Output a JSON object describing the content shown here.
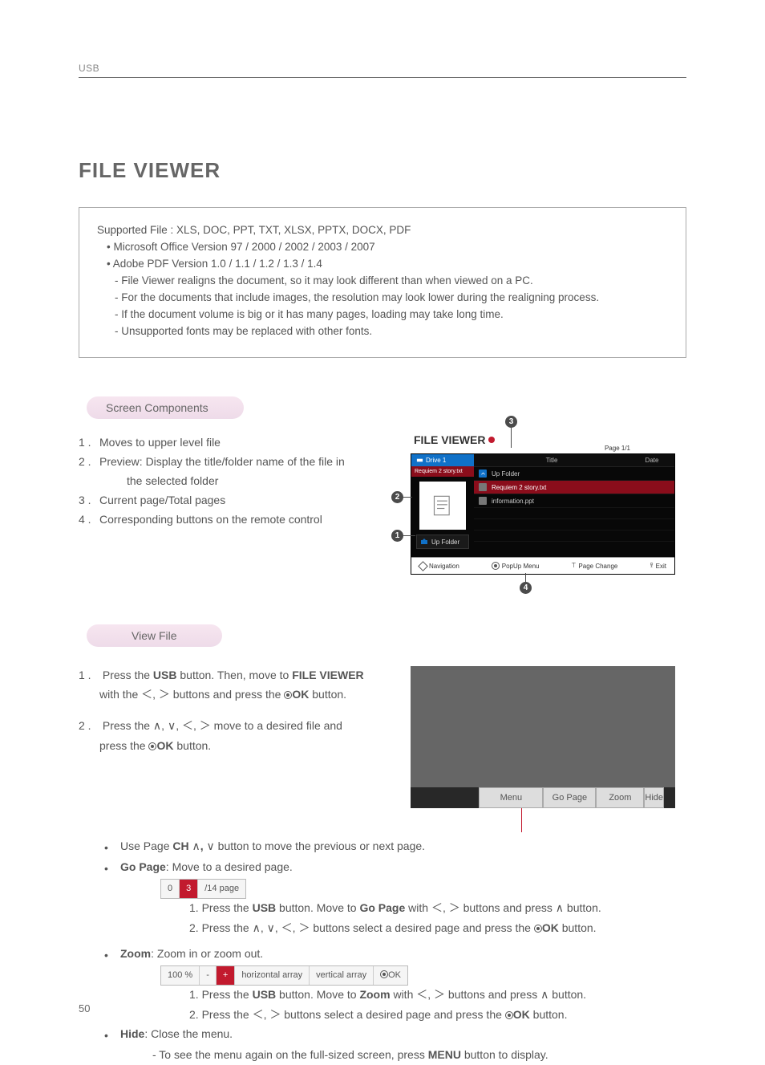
{
  "header": {
    "label": "USB",
    "page_number": "50"
  },
  "title": "FILE VIEWER",
  "box": {
    "line1": "Supported File : XLS, DOC, PPT, TXT, XLSX, PPTX, DOCX, PDF",
    "b1": "Microsoft Office Version 97 / 2000 / 2002 / 2003 / 2007",
    "b2": "Adobe PDF Version 1.0 / 1.1 / 1.2 / 1.3 / 1.4",
    "d1": "- File Viewer realigns the document, so it may look different than when viewed on a PC.",
    "d2": "- For the documents that include images, the resolution may look lower during the realigning process.",
    "d3": "- If the document volume is big or it has many pages, loading may take long time.",
    "d4": "- Unsupported fonts may be replaced with other fonts."
  },
  "section1": {
    "heading": "Screen Components",
    "items": {
      "n1": "1 .",
      "t1": "Moves to upper level file",
      "n2": "2 .",
      "t2": "Preview: Display the title/folder name of the file in",
      "t2b": "the selected folder",
      "n3": "3 .",
      "t3": "Current page/Total pages",
      "n4": "4 .",
      "t4": "Corresponding buttons on the remote control"
    },
    "callouts": {
      "c1": "1",
      "c2": "2",
      "c3": "3",
      "c4": "4"
    }
  },
  "fv": {
    "title": "FILE VIEWER",
    "page": "Page 1/1",
    "drive": "Drive 1",
    "selected": "Requiem 2 story.txt",
    "up_folder": "Up Folder",
    "col_title": "Title",
    "col_date": "Date",
    "rows": {
      "r0": "Up Folder",
      "r1": "Requiem 2 story.txt",
      "r2": "information.ppt"
    },
    "footer": {
      "nav": "Navigation",
      "popup": "PopUp Menu",
      "page": "Page Change",
      "exit": "Exit",
      "btnb": "ꔋ"
    }
  },
  "section2": {
    "heading": "View File",
    "s1a": "1 .",
    "s1b_pre": "Press the ",
    "s1b_usb": "USB",
    "s1b_mid": " button. Then, move to ",
    "s1b_fv": "FILE VIEWER",
    "s1c_pre": "with the ",
    "s1c_post": " buttons and press the ",
    "s1c_ok": "OK",
    "s1c_end": " button.",
    "s2a": "2 .",
    "s2b_pre": "Press the ",
    "s2b_mid": " move to a desired file and",
    "s2c_pre": "press the ",
    "s2c_ok": "OK",
    "s2c_end": " button."
  },
  "viewer_bar": {
    "menu": "Menu",
    "gopage": "Go Page",
    "zoom": "Zoom",
    "hide": "Hide"
  },
  "bullets": {
    "l1_pre": "Use Page ",
    "l1_ch": "CH",
    "l1_mid": " button to move the previous or next page.",
    "l2_gp": "Go Page",
    "l2_rest": ": Move to a desired page.",
    "gp_widget": {
      "a": "0",
      "b": "3",
      "c": "/14 page"
    },
    "gp_s1_pre": "1. Press the ",
    "gp_s1_usb": "USB",
    "gp_s1_mid": " button. Move to ",
    "gp_s1_gp": "Go Page",
    "gp_s1_mid2": " with ",
    "gp_s1_post": " buttons and press ",
    "gp_s1_end": " button.",
    "gp_s2_pre": "2. Press the ",
    "gp_s2_mid": " buttons select a desired page and press the ",
    "gp_s2_ok": "OK",
    "gp_s2_end": " button.",
    "l3_zoom": "Zoom",
    "l3_rest": ": Zoom in or zoom out.",
    "zoom_widget": {
      "a": "100 %",
      "b": "-",
      "c": "+",
      "d": "horizontal array",
      "e": "vertical array",
      "f": "OK"
    },
    "z_s1_pre": "1. Press the ",
    "z_s1_usb": "USB",
    "z_s1_mid": " button. Move to ",
    "z_s1_z": "Zoom",
    "z_s1_mid2": " with ",
    "z_s1_post": " buttons and press ",
    "z_s1_end": " button.",
    "z_s2_pre": "2. Press the ",
    "z_s2_mid": " buttons select a desired page and press the ",
    "z_s2_ok": "OK",
    "z_s2_end": " button.",
    "l4_hide": "Hide",
    "l4_rest": ": Close the menu.",
    "l4_sub": "- To see the menu again on the full-sized screen, press ",
    "l4_menu": "MENU",
    "l4_sub2": " button to display."
  },
  "glyphs": {
    "lt": "＜",
    "gt": "＞",
    "up": "∧",
    "down": "∨",
    "comma": ","
  }
}
